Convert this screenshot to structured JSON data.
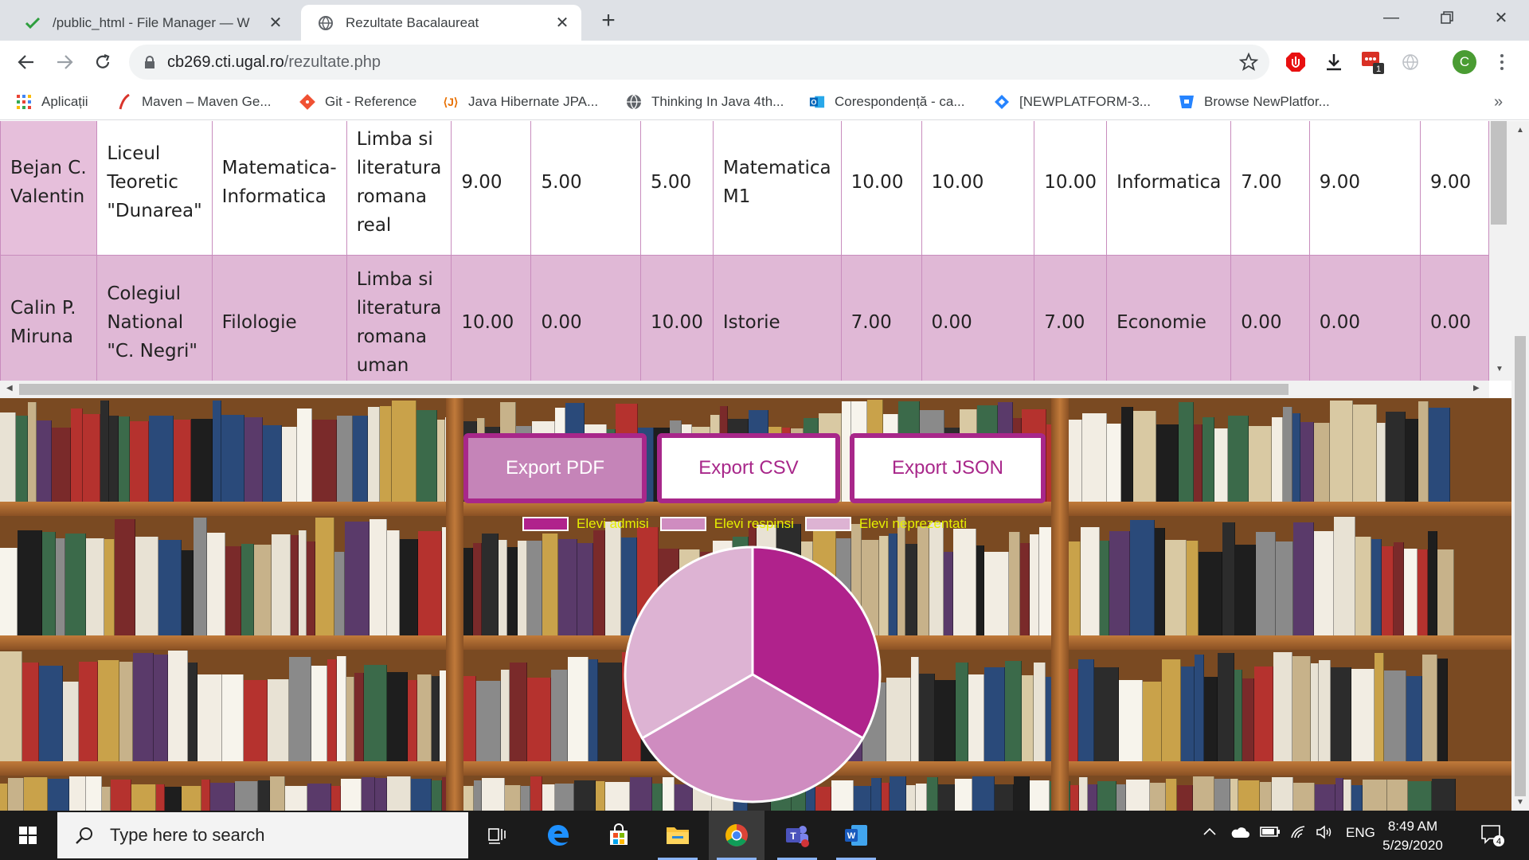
{
  "tabs": [
    {
      "title": "/public_html - File Manager — W",
      "active": false
    },
    {
      "title": "Rezultate Bacalaureat",
      "active": true
    }
  ],
  "omnibox": {
    "host": "cb269.cti.ugal.ro",
    "path": "/rezultate.php"
  },
  "avatar_letter": "C",
  "ext_badge": "1",
  "bookmarks": [
    {
      "label": "Aplicații",
      "icon": "apps-grid-icon"
    },
    {
      "label": "Maven – Maven Ge...",
      "icon": "maven-feather-icon"
    },
    {
      "label": "Git - Reference",
      "icon": "git-icon"
    },
    {
      "label": "Java Hibernate JPA...",
      "icon": "java-icon"
    },
    {
      "label": "Thinking In Java 4th...",
      "icon": "globe-icon"
    },
    {
      "label": "Corespondență - ca...",
      "icon": "outlook-icon"
    },
    {
      "label": "[NEWPLATFORM-3...",
      "icon": "jira-icon"
    },
    {
      "label": "Browse NewPlatfor...",
      "icon": "bitbucket-icon"
    }
  ],
  "table_rows": [
    [
      "Bejan C. Valentin",
      "Liceul Teoretic \"Dunarea\"",
      "Matematica-Informatica",
      "Limba si literatura romana real",
      "9.00",
      "5.00",
      "5.00",
      "Matematica M1",
      "10.00",
      "10.00",
      "10.00",
      "Informatica",
      "7.00",
      "9.00",
      "9.00"
    ],
    [
      "Calin P. Miruna",
      "Colegiul National \"C. Negri\"",
      "Filologie",
      "Limba si literatura romana uman",
      "10.00",
      "0.00",
      "10.00",
      "Istorie",
      "7.00",
      "0.00",
      "7.00",
      "Economie",
      "0.00",
      "0.00",
      "0.00"
    ]
  ],
  "buttons": {
    "pdf": "Export PDF",
    "csv": "Export CSV",
    "json": "Export JSON"
  },
  "chart_data": {
    "type": "pie",
    "series": [
      {
        "name": "Elevi admisi",
        "value": 1,
        "color": "#b0228c"
      },
      {
        "name": "Elevi respinsi",
        "value": 1,
        "color": "#cf8cc0"
      },
      {
        "name": "Elevi neprezentati",
        "value": 1,
        "color": "#ddb3d3"
      }
    ],
    "legend_position": "top",
    "legend_text_color": "#e6f000"
  },
  "taskbar": {
    "search_placeholder": "Type here to search",
    "time": "8:49 AM",
    "date": "5/29/2020",
    "lang": "ENG",
    "notif_count": "4"
  }
}
